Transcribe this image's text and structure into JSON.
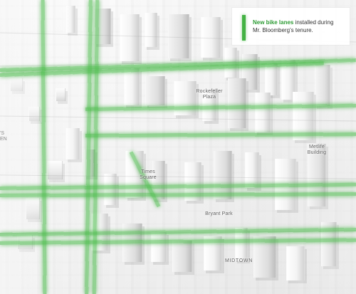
{
  "map": {
    "legend": {
      "highlight": "New bike lanes",
      "text": " installed during Mr. Bloomberg’s tenure.",
      "swatch_color": "#43b243",
      "highlight_color": "#2e9c35"
    },
    "labels": {
      "rockefeller": "Rockefeller\nPlaza",
      "metlife": "Metlife\nBuilding",
      "times_square": "Times\nSquare",
      "bryant_park": "Bryant Park",
      "midtown": "MIDTOWN",
      "edge_left": "'S\nEN"
    }
  }
}
